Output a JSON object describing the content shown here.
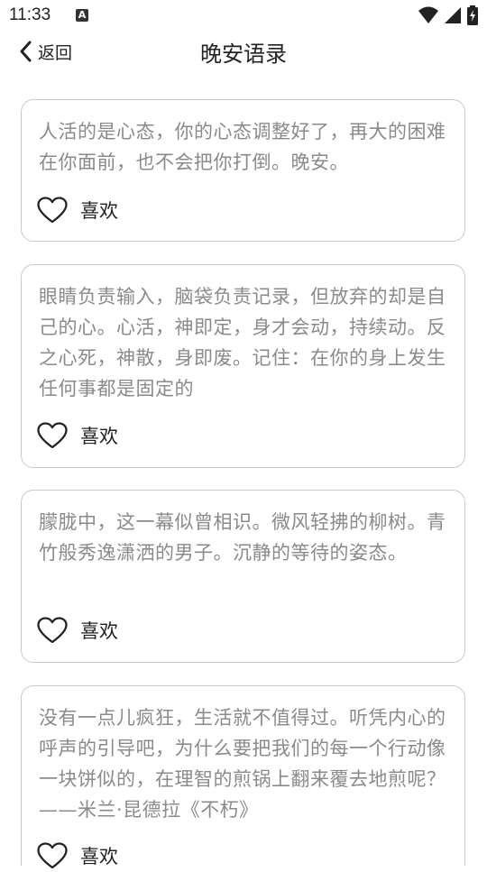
{
  "status_bar": {
    "time": "11:33",
    "notification_icon": "A"
  },
  "header": {
    "back_label": "返回",
    "title": "晚安语录"
  },
  "cards": [
    {
      "text": "人活的是心态，你的心态调整好了，再大的困难在你面前，也不会把你打倒。晚安。",
      "like_label": "喜欢"
    },
    {
      "text": "眼睛负责输入，脑袋负责记录，但放弃的却是自己的心。心活，神即定，身才会动，持续动。反之心死，神散，身即废。记住：在你的身上发生任何事都是固定的",
      "like_label": "喜欢"
    },
    {
      "text": "朦胧中，这一幕似曾相识。微风轻拂的柳树。青竹般秀逸潇洒的男子。沉静的等待的姿态。",
      "like_label": "喜欢"
    },
    {
      "text": "没有一点儿疯狂，生活就不值得过。听凭内心的呼声的引导吧，为什么要把我们的每一个行动像一块饼似的，在理智的煎锅上翻来覆去地煎呢？——米兰·昆德拉《不朽》",
      "like_label": "喜欢"
    }
  ],
  "icons": {
    "back": "chevron-left-icon",
    "like": "heart-outline-icon",
    "wifi": "wifi-icon",
    "signal": "signal-icon",
    "battery": "battery-icon"
  }
}
